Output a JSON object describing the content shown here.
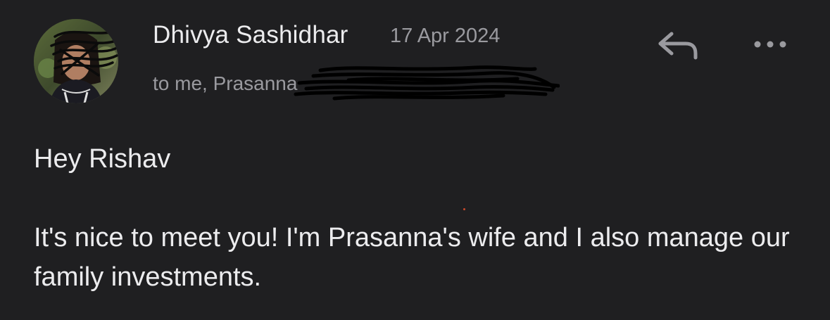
{
  "message": {
    "sender_name": "Dhivya Sashidhar",
    "date": "17 Apr 2024",
    "recipients": "to me, Prasanna",
    "body": {
      "greeting": "Hey Rishav",
      "paragraph": "It's nice to meet you! I'm Prasanna's wife and I also manage our family investments."
    }
  },
  "icons": {
    "reply": "reply-arrow-icon",
    "more": "more-horizontal-icon"
  },
  "colors": {
    "background": "#1f1f21",
    "primary_text": "#ececee",
    "secondary_text": "#9a9a9f"
  }
}
